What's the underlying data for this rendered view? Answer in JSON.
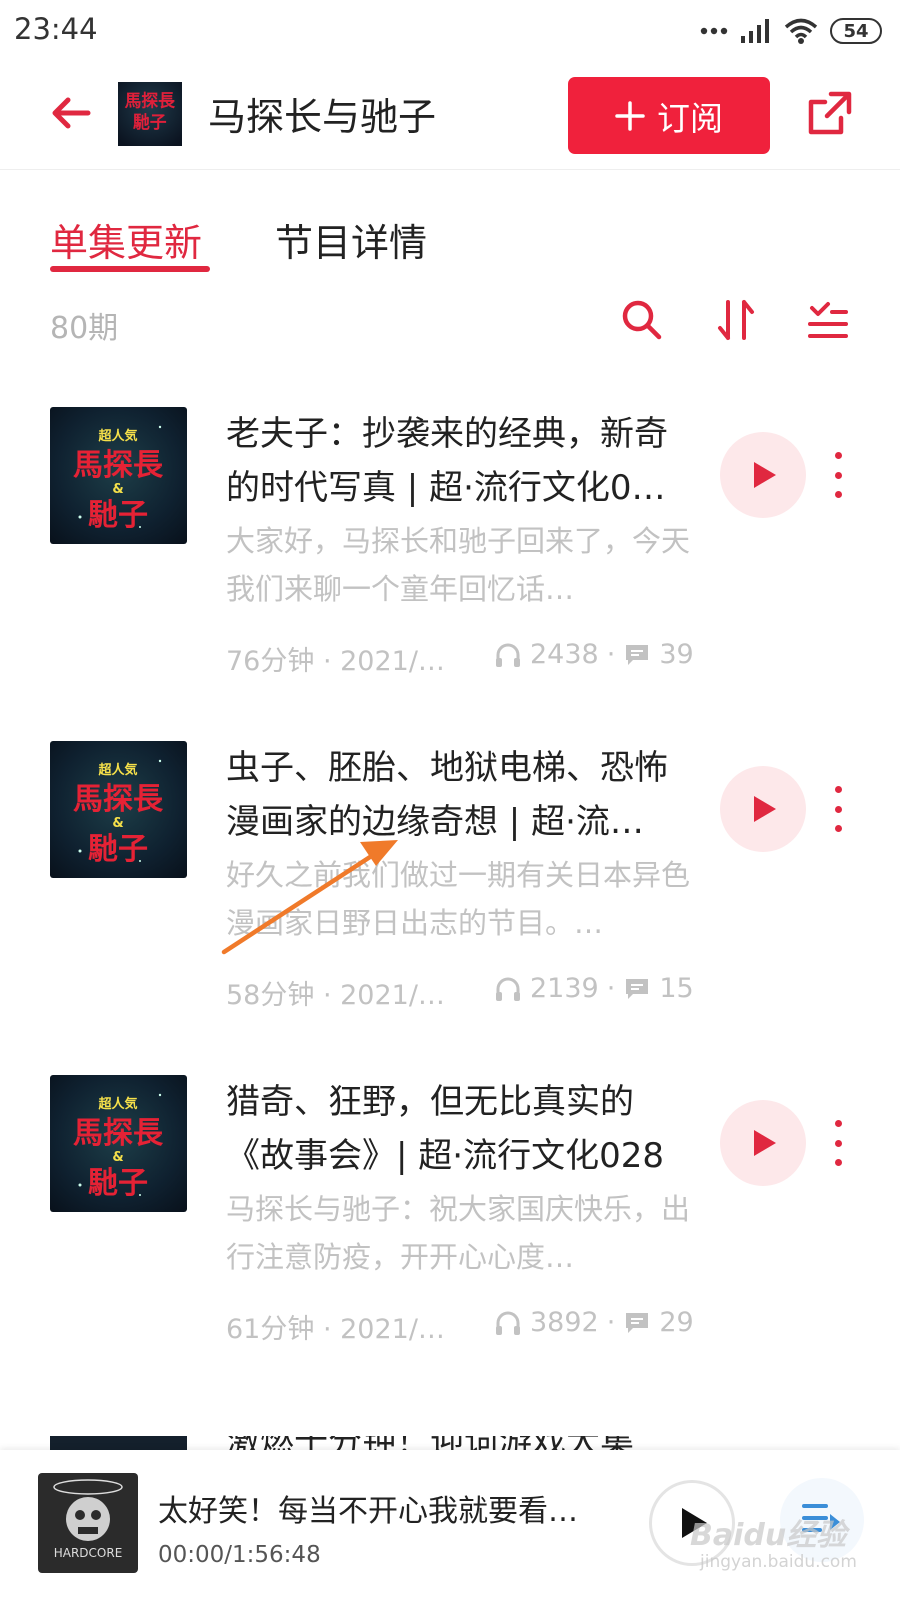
{
  "status_bar": {
    "time": "23:44",
    "battery": "54"
  },
  "header": {
    "title": "马探长与驰子",
    "subscribe_label": "订阅"
  },
  "tabs": [
    {
      "label": "单集更新",
      "active": true
    },
    {
      "label": "节目详情",
      "active": false
    }
  ],
  "toolbar": {
    "episode_count": "80期"
  },
  "cover_art": {
    "top_text": "超人気",
    "line1": "馬探長",
    "amp": "&",
    "line2": "馳子"
  },
  "episodes": [
    {
      "title": "老夫子：抄袭来的经典，新奇的时代写真 | 超·流行文化0…",
      "description": "大家好，马探长和驰子回来了，今天我们来聊一个童年回忆话…",
      "duration_date": "76分钟 · 2021/1…",
      "plays": "2438",
      "comments": "39"
    },
    {
      "title": "虫子、胚胎、地狱电梯、恐怖漫画家的边缘奇想 | 超·流…",
      "description": "好久之前我们做过一期有关日本异色漫画家日野日出志的节目。…",
      "duration_date": "58分钟 · 2021/1…",
      "plays": "2139",
      "comments": "15"
    },
    {
      "title": "猎奇、狂野，但无比真实的《故事会》| 超·流行文化028",
      "description": "马探长与驰子：祝大家国庆快乐，出行注意防疫，开开心心度…",
      "duration_date": "61分钟 · 2021/0…",
      "plays": "3892",
      "comments": "29"
    }
  ],
  "partial_episode": {
    "title": "激燃十分钟！迎词游戏大集"
  },
  "mini_player": {
    "title": "太好笑！每当不开心我就要看…",
    "time": "00:00/1:56:48",
    "cover_label": "HARDCORE"
  },
  "watermark": {
    "main": "Baidu经验",
    "sub": "jingyan.baidu.com"
  },
  "colors": {
    "accent": "#e02840",
    "subscribe": "#f0213c",
    "muted": "#c2c2c2"
  }
}
